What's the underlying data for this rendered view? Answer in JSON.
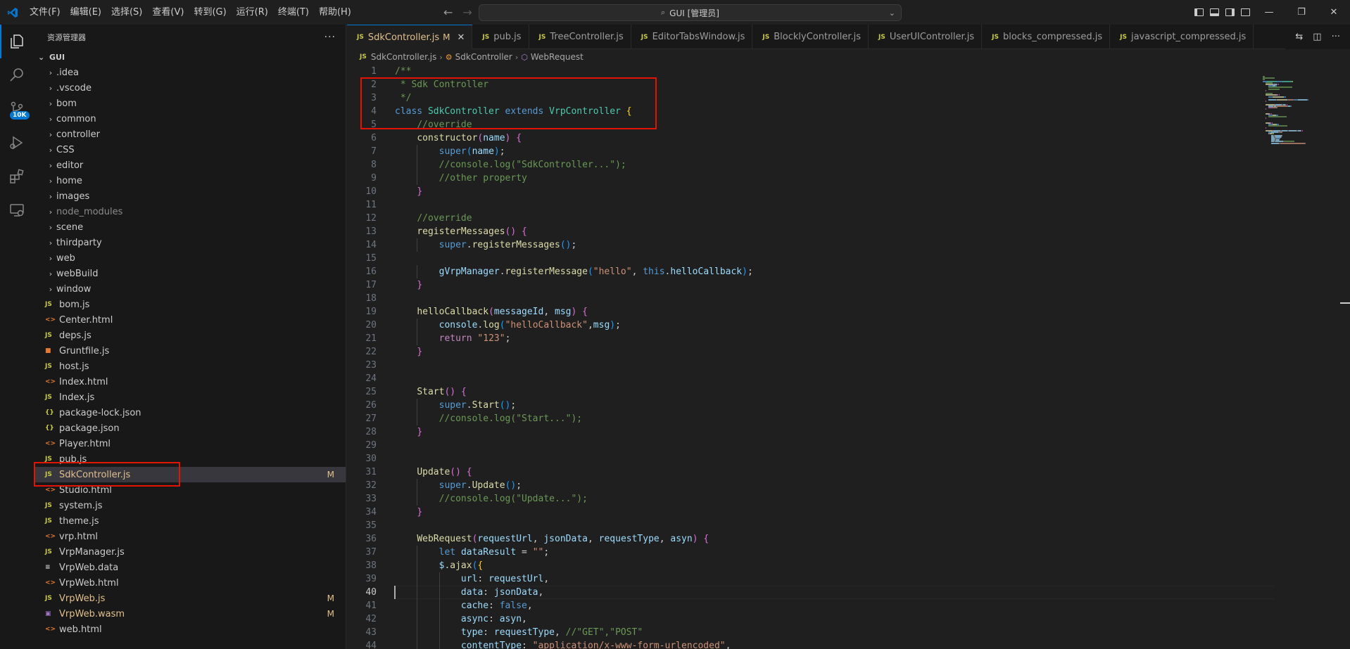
{
  "menu": [
    "文件(F)",
    "编辑(E)",
    "选择(S)",
    "查看(V)",
    "转到(G)",
    "运行(R)",
    "终端(T)",
    "帮助(H)"
  ],
  "command_center": {
    "label": "GUI [管理员]"
  },
  "activity": {
    "source_control_badge": "10K"
  },
  "sidebar": {
    "title": "资源管理器",
    "root": "GUI",
    "items": [
      {
        "type": "folder",
        "label": ".idea"
      },
      {
        "type": "folder",
        "label": ".vscode"
      },
      {
        "type": "folder",
        "label": "bom"
      },
      {
        "type": "folder",
        "label": "common"
      },
      {
        "type": "folder",
        "label": "controller"
      },
      {
        "type": "folder",
        "label": "CSS"
      },
      {
        "type": "folder",
        "label": "editor"
      },
      {
        "type": "folder",
        "label": "home"
      },
      {
        "type": "folder",
        "label": "images"
      },
      {
        "type": "folder",
        "label": "node_modules",
        "dim": true
      },
      {
        "type": "folder",
        "label": "scene"
      },
      {
        "type": "folder",
        "label": "thirdparty"
      },
      {
        "type": "folder",
        "label": "web"
      },
      {
        "type": "folder",
        "label": "webBuild"
      },
      {
        "type": "folder",
        "label": "window"
      },
      {
        "type": "file",
        "icon": "JS",
        "kind": "js",
        "label": "bom.js"
      },
      {
        "type": "file",
        "icon": "<>",
        "kind": "html",
        "label": "Center.html"
      },
      {
        "type": "file",
        "icon": "JS",
        "kind": "js",
        "label": "deps.js"
      },
      {
        "type": "file",
        "icon": "■",
        "kind": "grunt",
        "label": "Gruntfile.js"
      },
      {
        "type": "file",
        "icon": "JS",
        "kind": "js",
        "label": "host.js"
      },
      {
        "type": "file",
        "icon": "<>",
        "kind": "html",
        "label": "Index.html"
      },
      {
        "type": "file",
        "icon": "JS",
        "kind": "js",
        "label": "Index.js"
      },
      {
        "type": "file",
        "icon": "{}",
        "kind": "json",
        "label": "package-lock.json"
      },
      {
        "type": "file",
        "icon": "{}",
        "kind": "json",
        "label": "package.json"
      },
      {
        "type": "file",
        "icon": "<>",
        "kind": "html",
        "label": "Player.html"
      },
      {
        "type": "file",
        "icon": "JS",
        "kind": "js",
        "label": "pub.js"
      },
      {
        "type": "file",
        "icon": "JS",
        "kind": "js",
        "label": "SdkController.js",
        "modified": true,
        "selected": true,
        "mark": "M"
      },
      {
        "type": "file",
        "icon": "<>",
        "kind": "html",
        "label": "Studio.html"
      },
      {
        "type": "file",
        "icon": "JS",
        "kind": "js",
        "label": "system.js"
      },
      {
        "type": "file",
        "icon": "JS",
        "kind": "js",
        "label": "theme.js"
      },
      {
        "type": "file",
        "icon": "<>",
        "kind": "html",
        "label": "vrp.html"
      },
      {
        "type": "file",
        "icon": "JS",
        "kind": "js",
        "label": "VrpManager.js"
      },
      {
        "type": "file",
        "icon": "≡",
        "kind": "data",
        "label": "VrpWeb.data"
      },
      {
        "type": "file",
        "icon": "<>",
        "kind": "html",
        "label": "VrpWeb.html"
      },
      {
        "type": "file",
        "icon": "JS",
        "kind": "js",
        "label": "VrpWeb.js",
        "modified": true,
        "mark": "M"
      },
      {
        "type": "file",
        "icon": "▣",
        "kind": "wasm",
        "label": "VrpWeb.wasm",
        "modified": true,
        "mark": "M"
      },
      {
        "type": "file",
        "icon": "<>",
        "kind": "html",
        "label": "web.html"
      }
    ]
  },
  "tabs": [
    {
      "label": "SdkController.js",
      "mod": "M",
      "active": true
    },
    {
      "label": "pub.js"
    },
    {
      "label": "TreeController.js"
    },
    {
      "label": "EditorTabsWindow.js"
    },
    {
      "label": "BlocklyController.js"
    },
    {
      "label": "UserUIController.js"
    },
    {
      "label": "blocks_compressed.js"
    },
    {
      "label": "javascript_compressed.js"
    }
  ],
  "breadcrumb": {
    "file": "SdkController.js",
    "class": "SdkController",
    "method": "WebRequest"
  },
  "editor": {
    "current_line": 40,
    "lines": [
      [
        [
          "c",
          "/**"
        ]
      ],
      [
        [
          "c",
          " * Sdk Controller"
        ]
      ],
      [
        [
          "c",
          " */"
        ]
      ],
      [
        [
          "k",
          "class "
        ],
        [
          "t",
          "SdkController "
        ],
        [
          "k",
          "extends "
        ],
        [
          "t",
          "VrpController "
        ],
        [
          "b1",
          "{"
        ]
      ],
      [
        [
          "p",
          "    "
        ],
        [
          "c",
          "//override"
        ]
      ],
      [
        [
          "p",
          "    "
        ],
        [
          "f",
          "constructor"
        ],
        [
          "b2",
          "("
        ],
        [
          "v",
          "name"
        ],
        [
          "b2",
          ")"
        ],
        [
          "p",
          " "
        ],
        [
          "b2",
          "{"
        ]
      ],
      [
        [
          "p",
          "        "
        ],
        [
          "k",
          "super"
        ],
        [
          "b3",
          "("
        ],
        [
          "v",
          "name"
        ],
        [
          "b3",
          ")"
        ],
        [
          "p",
          ";"
        ]
      ],
      [
        [
          "p",
          "        "
        ],
        [
          "c",
          "//console.log(\"SdkController...\");"
        ]
      ],
      [
        [
          "p",
          "        "
        ],
        [
          "c",
          "//other property"
        ]
      ],
      [
        [
          "p",
          "    "
        ],
        [
          "b2",
          "}"
        ]
      ],
      [],
      [
        [
          "p",
          "    "
        ],
        [
          "c",
          "//override"
        ]
      ],
      [
        [
          "p",
          "    "
        ],
        [
          "f",
          "registerMessages"
        ],
        [
          "b2",
          "()"
        ],
        [
          "p",
          " "
        ],
        [
          "b2",
          "{"
        ]
      ],
      [
        [
          "p",
          "        "
        ],
        [
          "k",
          "super"
        ],
        [
          "p",
          "."
        ],
        [
          "f",
          "registerMessages"
        ],
        [
          "b3",
          "()"
        ],
        [
          "p",
          ";"
        ]
      ],
      [],
      [
        [
          "p",
          "        "
        ],
        [
          "v",
          "gVrpManager"
        ],
        [
          "p",
          "."
        ],
        [
          "f",
          "registerMessage"
        ],
        [
          "b3",
          "("
        ],
        [
          "s",
          "\"hello\""
        ],
        [
          "p",
          ", "
        ],
        [
          "k",
          "this"
        ],
        [
          "p",
          "."
        ],
        [
          "v",
          "helloCallback"
        ],
        [
          "b3",
          ")"
        ],
        [
          "p",
          ";"
        ]
      ],
      [
        [
          "p",
          "    "
        ],
        [
          "b2",
          "}"
        ]
      ],
      [],
      [
        [
          "p",
          "    "
        ],
        [
          "f",
          "helloCallback"
        ],
        [
          "b2",
          "("
        ],
        [
          "v",
          "messageId"
        ],
        [
          "p",
          ", "
        ],
        [
          "v",
          "msg"
        ],
        [
          "b2",
          ")"
        ],
        [
          "p",
          " "
        ],
        [
          "b2",
          "{"
        ]
      ],
      [
        [
          "p",
          "        "
        ],
        [
          "v",
          "console"
        ],
        [
          "p",
          "."
        ],
        [
          "f",
          "log"
        ],
        [
          "b3",
          "("
        ],
        [
          "s",
          "\"helloCallback\""
        ],
        [
          "p",
          ","
        ],
        [
          "v",
          "msg"
        ],
        [
          "b3",
          ")"
        ],
        [
          "p",
          ";"
        ]
      ],
      [
        [
          "p",
          "        "
        ],
        [
          "x",
          "return "
        ],
        [
          "s",
          "\"123\""
        ],
        [
          "p",
          ";"
        ]
      ],
      [
        [
          "p",
          "    "
        ],
        [
          "b2",
          "}"
        ]
      ],
      [],
      [],
      [
        [
          "p",
          "    "
        ],
        [
          "f",
          "Start"
        ],
        [
          "b2",
          "()"
        ],
        [
          "p",
          " "
        ],
        [
          "b2",
          "{"
        ]
      ],
      [
        [
          "p",
          "        "
        ],
        [
          "k",
          "super"
        ],
        [
          "p",
          "."
        ],
        [
          "f",
          "Start"
        ],
        [
          "b3",
          "()"
        ],
        [
          "p",
          ";"
        ]
      ],
      [
        [
          "p",
          "        "
        ],
        [
          "c",
          "//console.log(\"Start...\");"
        ]
      ],
      [
        [
          "p",
          "    "
        ],
        [
          "b2",
          "}"
        ]
      ],
      [],
      [],
      [
        [
          "p",
          "    "
        ],
        [
          "f",
          "Update"
        ],
        [
          "b2",
          "()"
        ],
        [
          "p",
          " "
        ],
        [
          "b2",
          "{"
        ]
      ],
      [
        [
          "p",
          "        "
        ],
        [
          "k",
          "super"
        ],
        [
          "p",
          "."
        ],
        [
          "f",
          "Update"
        ],
        [
          "b3",
          "()"
        ],
        [
          "p",
          ";"
        ]
      ],
      [
        [
          "p",
          "        "
        ],
        [
          "c",
          "//console.log(\"Update...\");"
        ]
      ],
      [
        [
          "p",
          "    "
        ],
        [
          "b2",
          "}"
        ]
      ],
      [],
      [
        [
          "p",
          "    "
        ],
        [
          "f",
          "WebRequest"
        ],
        [
          "b2",
          "("
        ],
        [
          "v",
          "requestUrl"
        ],
        [
          "p",
          ", "
        ],
        [
          "v",
          "jsonData"
        ],
        [
          "p",
          ", "
        ],
        [
          "v",
          "requestType"
        ],
        [
          "p",
          ", "
        ],
        [
          "v",
          "asyn"
        ],
        [
          "b2",
          ")"
        ],
        [
          "p",
          " "
        ],
        [
          "b2",
          "{"
        ]
      ],
      [
        [
          "p",
          "        "
        ],
        [
          "k",
          "let "
        ],
        [
          "v",
          "dataResult"
        ],
        [
          "p",
          " = "
        ],
        [
          "s",
          "\"\""
        ],
        [
          "p",
          ";"
        ]
      ],
      [
        [
          "p",
          "        "
        ],
        [
          "v",
          "$"
        ],
        [
          "p",
          "."
        ],
        [
          "f",
          "ajax"
        ],
        [
          "b3",
          "("
        ],
        [
          "b1",
          "{"
        ]
      ],
      [
        [
          "p",
          "            "
        ],
        [
          "v",
          "url"
        ],
        [
          "p",
          ": "
        ],
        [
          "v",
          "requestUrl"
        ],
        [
          "p",
          ","
        ]
      ],
      [
        [
          "p",
          "            "
        ],
        [
          "v",
          "data"
        ],
        [
          "p",
          ": "
        ],
        [
          "v",
          "jsonData"
        ],
        [
          "p",
          ","
        ]
      ],
      [
        [
          "p",
          "            "
        ],
        [
          "v",
          "cache"
        ],
        [
          "p",
          ": "
        ],
        [
          "k",
          "false"
        ],
        [
          "p",
          ","
        ]
      ],
      [
        [
          "p",
          "            "
        ],
        [
          "v",
          "async"
        ],
        [
          "p",
          ": "
        ],
        [
          "v",
          "asyn"
        ],
        [
          "p",
          ","
        ]
      ],
      [
        [
          "p",
          "            "
        ],
        [
          "v",
          "type"
        ],
        [
          "p",
          ": "
        ],
        [
          "v",
          "requestType"
        ],
        [
          "p",
          ", "
        ],
        [
          "c",
          "//\"GET\",\"POST\""
        ]
      ],
      [
        [
          "p",
          "            "
        ],
        [
          "v",
          "contentType"
        ],
        [
          "p",
          ": "
        ],
        [
          "s",
          "\"application/x-www-form-urlencoded\""
        ],
        [
          "p",
          ","
        ]
      ]
    ]
  }
}
